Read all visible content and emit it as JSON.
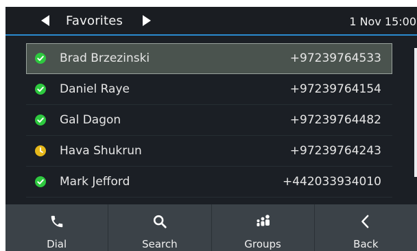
{
  "header": {
    "title": "Favorites",
    "datetime": "1 Nov 15:00"
  },
  "colors": {
    "accent": "#2a8bd0",
    "status_available": "#2ec93f",
    "status_away": "#e6b81a"
  },
  "contacts": [
    {
      "name": "Brad Brzezinski",
      "number": "+97239764533",
      "status": "available",
      "icon": "check-circle-icon",
      "selected": true
    },
    {
      "name": "Daniel Raye",
      "number": "+97239764154",
      "status": "available",
      "icon": "check-circle-icon",
      "selected": false
    },
    {
      "name": "Gal Dagon",
      "number": "+97239764482",
      "status": "available",
      "icon": "check-circle-icon",
      "selected": false
    },
    {
      "name": "Hava Shukrun",
      "number": "+97239764243",
      "status": "away",
      "icon": "clock-circle-icon",
      "selected": false
    },
    {
      "name": "Mark Jefford",
      "number": "+442033934010",
      "status": "available",
      "icon": "check-circle-icon",
      "selected": false
    }
  ],
  "softkeys": [
    {
      "label": "Dial",
      "icon": "phone-icon"
    },
    {
      "label": "Search",
      "icon": "search-icon"
    },
    {
      "label": "Groups",
      "icon": "groups-icon"
    },
    {
      "label": "Back",
      "icon": "back-chevron-icon"
    }
  ]
}
